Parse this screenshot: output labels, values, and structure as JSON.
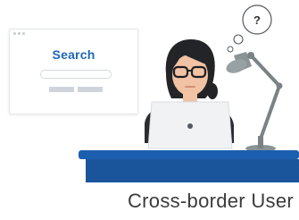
{
  "browser_window": {
    "title": "Search"
  },
  "thought_bubble": {
    "symbol": "?"
  },
  "caption": "Cross-border User",
  "colors": {
    "accent_blue": "#1f66b8",
    "desk_blue": "#1b5fae",
    "lamp_gray": "#8a9396",
    "laptop": "#f1f2f4",
    "skin": "#f2c2a4",
    "hair": "#222428"
  },
  "icons": [
    "browser-window",
    "thought-bubble",
    "question-mark",
    "desk-lamp",
    "laptop",
    "person-avatar"
  ]
}
